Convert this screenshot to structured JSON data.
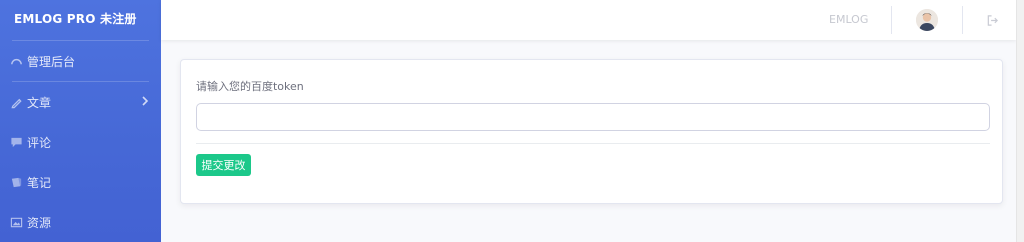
{
  "sidebar": {
    "brand": "EMLOG PRO 未注册",
    "items": [
      {
        "label": "管理后台",
        "icon": "dashboard-icon"
      },
      {
        "label": "文章",
        "icon": "pencil-icon",
        "has_submenu": true
      },
      {
        "label": "评论",
        "icon": "comment-icon"
      },
      {
        "label": "笔记",
        "icon": "note-icon"
      },
      {
        "label": "资源",
        "icon": "image-icon"
      }
    ],
    "colors": {
      "gradient_top": "#4e73df",
      "gradient_bottom": "#4362d3"
    }
  },
  "topbar": {
    "site_link": "EMLOG",
    "avatar_icon": "user-avatar",
    "logout_icon": "logout-icon"
  },
  "form": {
    "label": "请输入您的百度token",
    "input_value": "",
    "submit_label": "提交更改",
    "submit_color": "#1cc88a"
  }
}
